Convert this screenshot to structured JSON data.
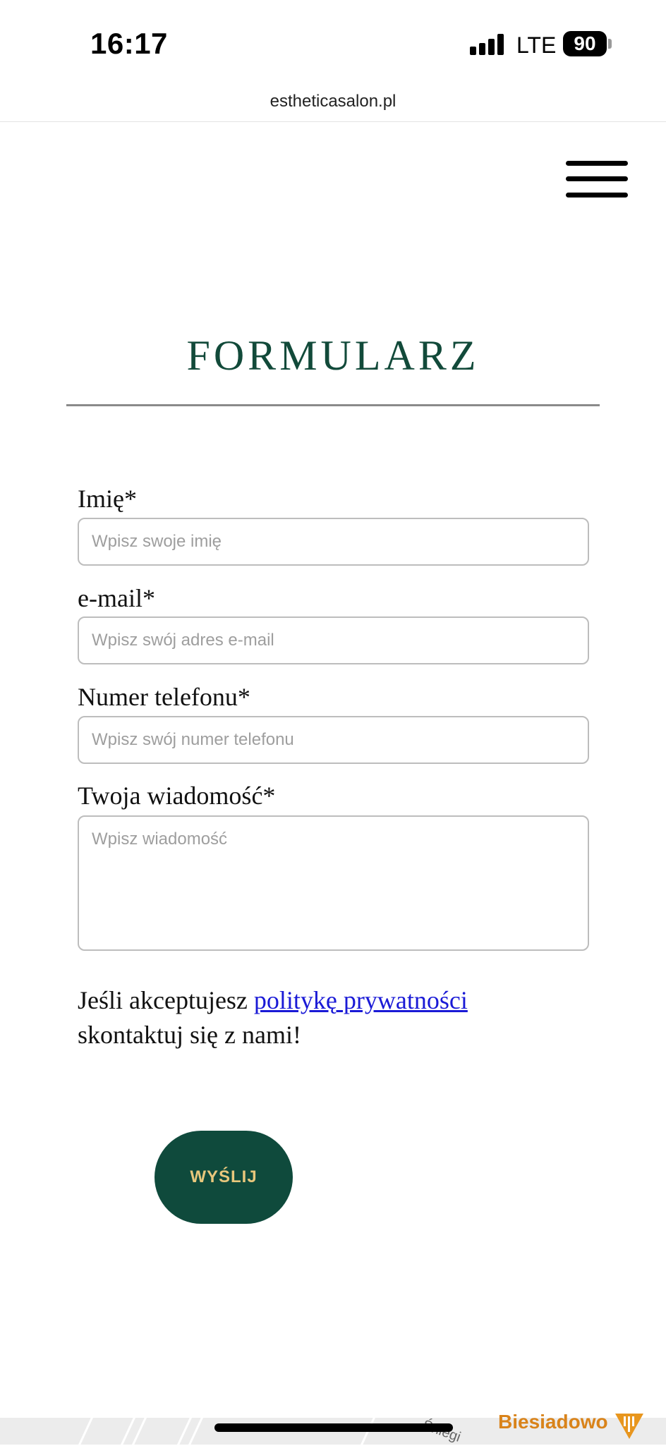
{
  "status_bar": {
    "time": "16:17",
    "network": "LTE",
    "battery": "90"
  },
  "browser": {
    "url": "estheticasalon.pl"
  },
  "nav": {
    "menu_icon": "hamburger-menu-icon"
  },
  "form": {
    "title": "FORMULARZ",
    "fields": {
      "name": {
        "label": "Imię*",
        "placeholder": "Wpisz swoje imię"
      },
      "email": {
        "label": "e-mail*",
        "placeholder": "Wpisz swój adres e-mail"
      },
      "phone": {
        "label": "Numer telefonu*",
        "placeholder": "Wpisz swój numer telefonu"
      },
      "message": {
        "label": "Twoja wiadomość*",
        "placeholder": "Wpisz wiadomość"
      }
    },
    "consent": {
      "prefix": "Jeśli akceptujesz ",
      "link_text": "politykę prywatności",
      "suffix": "skontaktuj się z nami!"
    },
    "submit_label": "WYŚLIJ"
  },
  "map": {
    "place_name": "Biesiadowo",
    "street_fragment": "Śniegi"
  },
  "colors": {
    "brand_green": "#0f4a3c",
    "title_green": "#124a3a",
    "button_text_gold": "#e8c77c",
    "link_blue": "#1a1ad6",
    "map_place_orange": "#d9831a"
  }
}
